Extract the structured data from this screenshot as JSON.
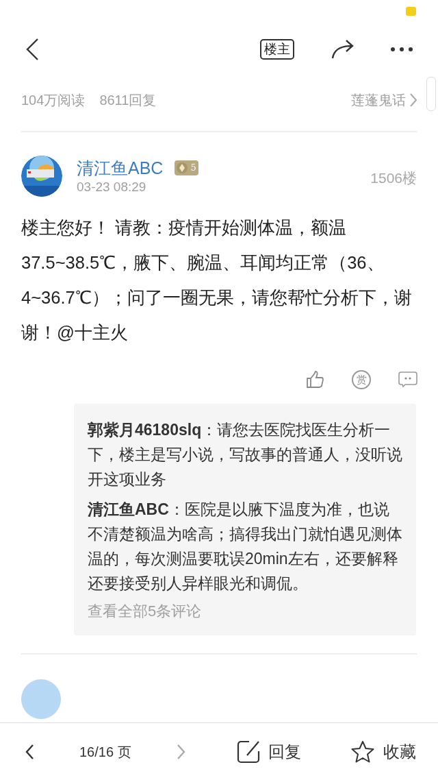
{
  "nav": {
    "op_filter": "楼主"
  },
  "stats": {
    "reads": "104万阅读",
    "replies": "8611回复",
    "forum": "莲蓬鬼话"
  },
  "post": {
    "author": "清江鱼ABC",
    "level": "5",
    "time": "03-23 08:29",
    "floor": "1506楼",
    "body": "楼主您好！ 请教：疫情开始测体温，额温37.5~38.5℃，腋下、腕温、耳闻均正常（36、4~36.7℃）；问了一圈无果，请您帮忙分析下，谢谢！@十主火",
    "reward": "赏",
    "comments": [
      {
        "text": "**郭紫月46180slq**：请您去医院找医生分析一下，楼主是写小说，写故事的普通人，没听说开这项业务"
      },
      {
        "text": "**清江鱼ABC**：医院是以腋下温度为准，也说不清楚额温为啥高；搞得我出门就怕遇见测体温的，每次测温要耽误20min左右，还要解释还要接受别人异样眼光和调侃。"
      }
    ],
    "more_comments": "查看全部5条评论"
  },
  "bottom_bar": {
    "prev_disabled": false,
    "page": "16/16 页",
    "next_disabled": true,
    "reply": "回复",
    "favorite": "收藏"
  }
}
